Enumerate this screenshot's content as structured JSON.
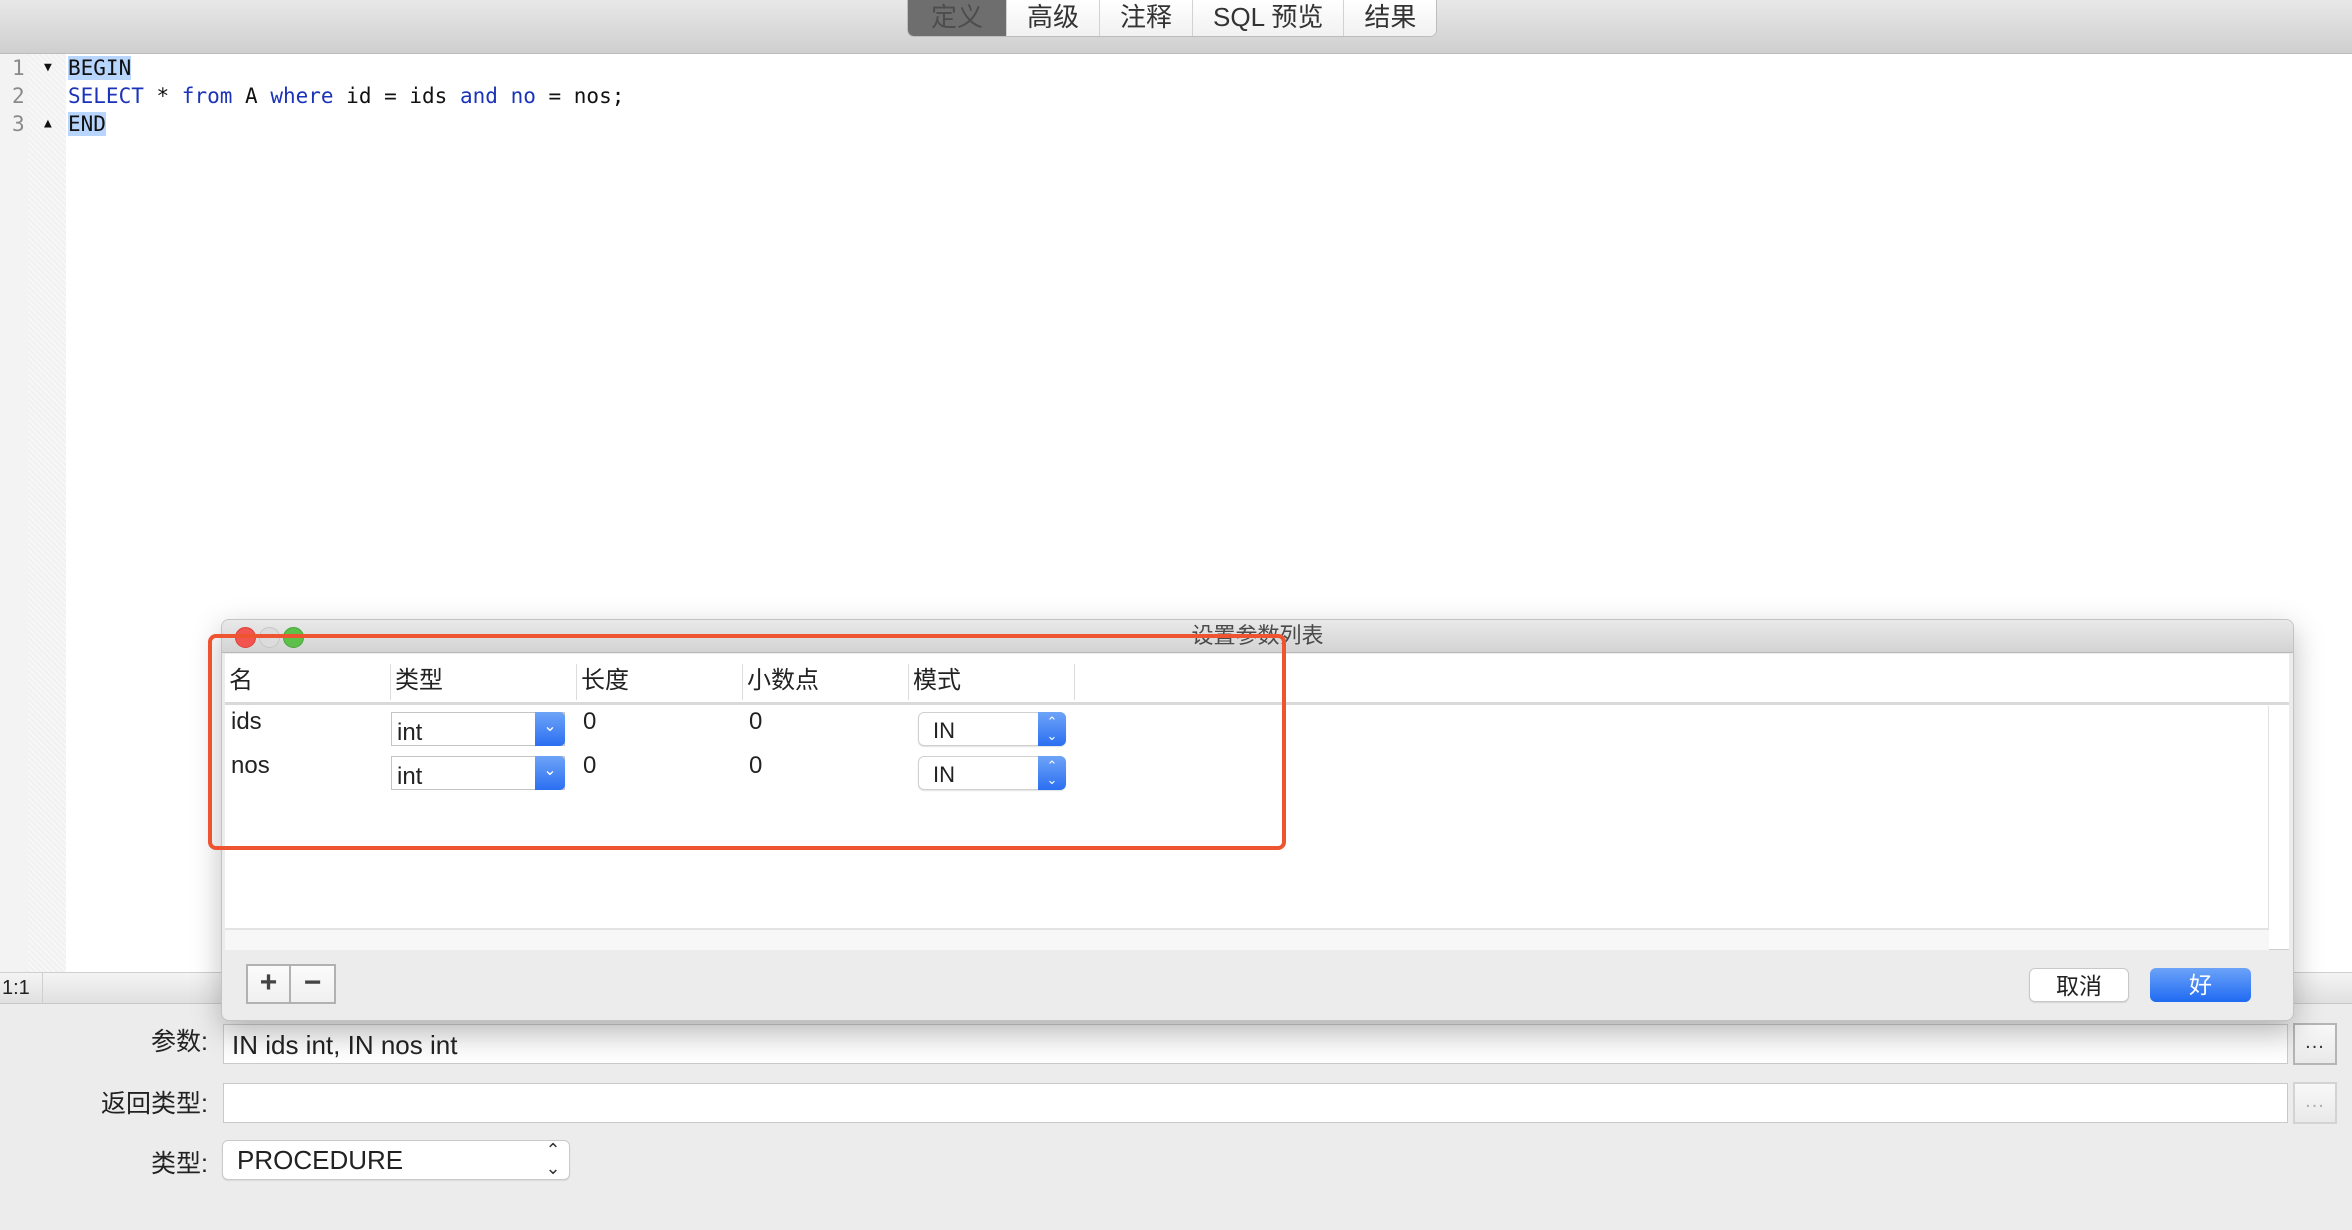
{
  "toolbar": {
    "tabs": [
      {
        "label": "定义",
        "active": true
      },
      {
        "label": "高级",
        "active": false
      },
      {
        "label": "注释",
        "active": false
      },
      {
        "label": "SQL 预览",
        "active": false
      },
      {
        "label": "结果",
        "active": false
      }
    ]
  },
  "editor": {
    "lines": [
      {
        "number": "1",
        "fold": "▼",
        "text": "BEGIN"
      },
      {
        "number": "2",
        "fold": "",
        "tokens": [
          {
            "t": "SELECT",
            "kw": true
          },
          {
            "t": " * ",
            "kw": false
          },
          {
            "t": "from",
            "kw": true
          },
          {
            "t": " A ",
            "kw": false
          },
          {
            "t": "where",
            "kw": true
          },
          {
            "t": " id = ids ",
            "kw": false
          },
          {
            "t": "and",
            "kw": true
          },
          {
            "t": " ",
            "kw": false
          },
          {
            "t": "no",
            "kw": true
          },
          {
            "t": " = nos;",
            "kw": false
          }
        ]
      },
      {
        "number": "3",
        "fold": "▲",
        "text": "END"
      }
    ],
    "cursor_position": "1:1"
  },
  "dialog": {
    "title": "设置参数列表",
    "columns": [
      "名",
      "类型",
      "长度",
      "小数点",
      "模式"
    ],
    "rows": [
      {
        "name": "ids",
        "type": "int",
        "length": "0",
        "decimals": "0",
        "mode": "IN"
      },
      {
        "name": "nos",
        "type": "int",
        "length": "0",
        "decimals": "0",
        "mode": "IN"
      }
    ],
    "add_label": "+",
    "remove_label": "−",
    "cancel_label": "取消",
    "ok_label": "好"
  },
  "form": {
    "params_label": "参数:",
    "params_value": "IN ids int, IN nos int",
    "return_type_label": "返回类型:",
    "return_type_value": "",
    "type_label": "类型:",
    "type_value": "PROCEDURE",
    "ellipsis": "..."
  },
  "colors": {
    "accent_blue": "#2b6ff2",
    "keyword_blue": "#1b33b8",
    "selection_highlight": "#b7d5fd",
    "annotation_red": "#ee5430"
  }
}
